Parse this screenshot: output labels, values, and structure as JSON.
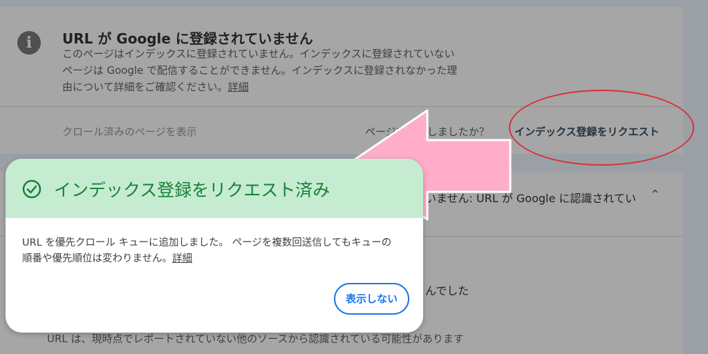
{
  "colors": {
    "overlay_bg": "#9aa0a6",
    "card_bg": "#a6a6a6",
    "success_header": "#c5ecd0",
    "success_text": "#188038",
    "link_blue": "#1a73e8",
    "arrow_pink": "#ffadc8",
    "highlight_red": "#d93036"
  },
  "status_card": {
    "icon": "info-icon",
    "title": "URL が Google に登録されていません",
    "description_line1": "このページはインデックスに登録されていません。インデックスに登録されていない",
    "description_line2": "ページは Google で配信することができません。インデックスに登録されなかった理",
    "description_line3_prefix": "由について詳細をご確認ください。",
    "learn_more": "詳細",
    "view_crawled_page": "クロール済みのページを表示",
    "page_changed_question": "ページを変更しましたか？",
    "request_indexing": "インデックス登録をリクエスト"
  },
  "coverage_card": {
    "heading": "いません: URL が Google に認識されてい",
    "expand_icon": "chevron-up-icon",
    "status_line": "んでした",
    "detail_line": "URL は、現時点でレポートされていない他のソースから認識されている可能性があります"
  },
  "dialog": {
    "icon": "check-circle-icon",
    "title": "インデックス登録をリクエスト済み",
    "message_line1": "URL を優先クロール キューに追加しました。 ページを複数回送信してもキューの",
    "message_line2_prefix": "順番や優先順位は変わりません。",
    "learn_more": "詳細",
    "dismiss_button": "表示しない"
  }
}
